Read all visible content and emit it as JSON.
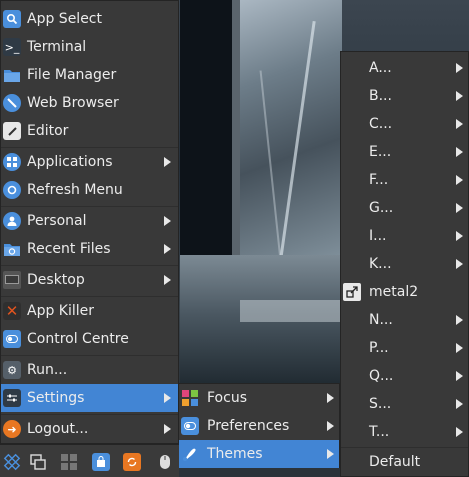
{
  "main_menu": {
    "items": [
      {
        "label": "App Select",
        "icon": "magnifier-icon",
        "color": "#4a8fdc"
      },
      {
        "label": "Terminal",
        "icon": "terminal-icon",
        "color": "#2f3a45"
      },
      {
        "label": "File Manager",
        "icon": "folder-icon",
        "color": "#4a8fdc"
      },
      {
        "label": "Web Browser",
        "icon": "globe-icon",
        "color": "#4a8fdc"
      },
      {
        "label": "Editor",
        "icon": "editor-icon",
        "color": "#e8e8e8"
      },
      {
        "label": "Applications",
        "icon": "applications-icon",
        "color": "#4a8fdc"
      },
      {
        "label": "Refresh Menu",
        "icon": "refresh-icon",
        "color": "#4a8fdc"
      },
      {
        "label": "Personal",
        "icon": "user-icon",
        "color": "#4a8fdc"
      },
      {
        "label": "Recent Files",
        "icon": "recent-folder-icon",
        "color": "#4a8fdc"
      },
      {
        "label": "Desktop",
        "icon": "desktop-icon",
        "color": "#555555"
      },
      {
        "label": "App Killer",
        "icon": "kill-icon",
        "color": "#e0541f"
      },
      {
        "label": "Control Centre",
        "icon": "toggle-icon",
        "color": "#4a8fdc"
      },
      {
        "label": "Run...",
        "icon": "run-gear-icon",
        "color": "#555f69"
      },
      {
        "label": "Settings",
        "icon": "sliders-icon",
        "color": "#2f3a45"
      },
      {
        "label": "Logout...",
        "icon": "logout-icon",
        "color": "#e87722"
      }
    ]
  },
  "settings_menu": {
    "items": [
      {
        "label": "Focus",
        "icon": "focus-grid-icon"
      },
      {
        "label": "Preferences",
        "icon": "preferences-toggle-icon"
      },
      {
        "label": "Themes",
        "icon": "themes-brush-icon"
      }
    ]
  },
  "themes_menu": {
    "items": [
      "A...",
      "B...",
      "C...",
      "E...",
      "F...",
      "G...",
      "I...",
      "K...",
      "metal2",
      "N...",
      "P...",
      "Q...",
      "S...",
      "T...",
      "Default"
    ],
    "current_theme_icon": "theme-shortcut-icon"
  },
  "taskbar": {
    "buttons": [
      {
        "icon": "app-grid-icon",
        "color": "#4a8fdc"
      },
      {
        "icon": "windows-icon",
        "color": "#dddddd"
      },
      {
        "icon": "workspaces-icon",
        "color": "#777777"
      },
      {
        "icon": "store-bag-icon",
        "color": "#4a8fdc"
      },
      {
        "icon": "update-icon",
        "color": "#e87722"
      },
      {
        "icon": "mouse-icon",
        "color": "#dddddd"
      }
    ]
  },
  "colors": {
    "menu_bg": "#393939",
    "highlight": "#4285d4",
    "text": "#ececec"
  }
}
